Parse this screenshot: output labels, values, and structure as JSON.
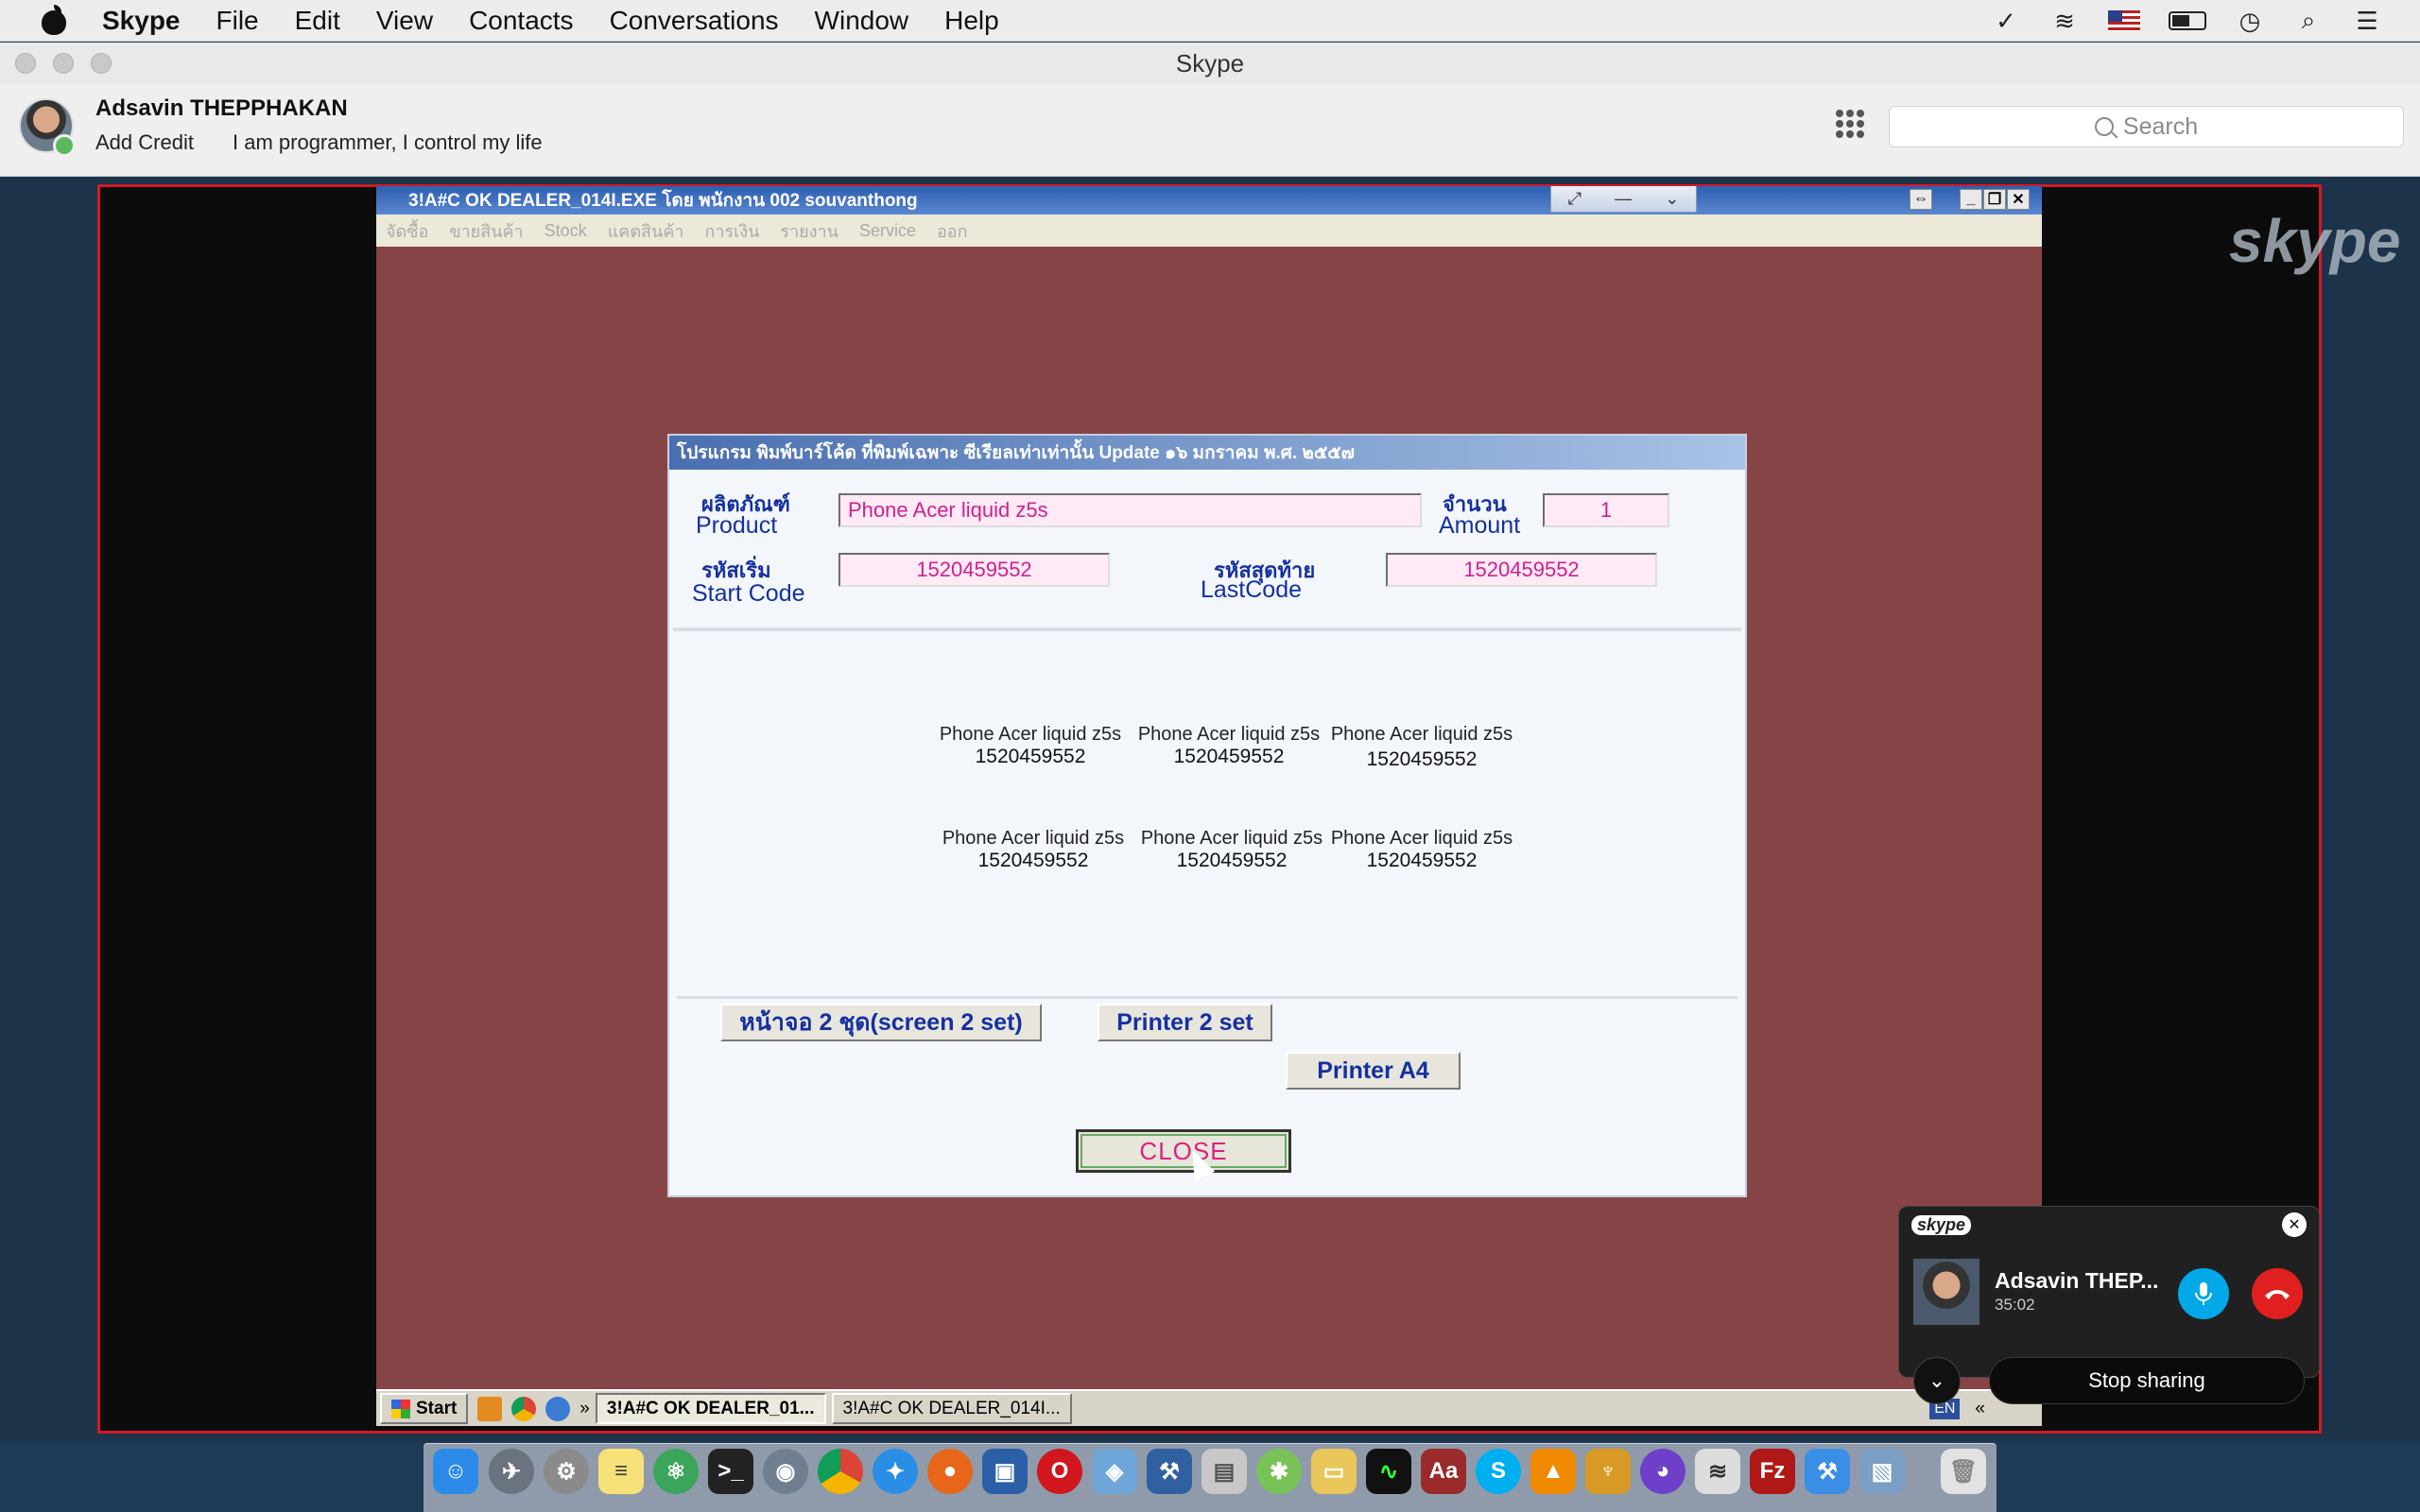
{
  "menubar": {
    "app": "Skype",
    "items": [
      "File",
      "Edit",
      "View",
      "Contacts",
      "Conversations",
      "Window",
      "Help"
    ],
    "status_icons": [
      "checkmark-shield-icon",
      "wifi-icon",
      "us-flag-icon",
      "battery-icon",
      "clock-icon",
      "spotlight-icon",
      "notification-list-icon"
    ]
  },
  "window": {
    "title": "Skype"
  },
  "profile": {
    "name": "Adsavin THEPPHAKAN",
    "add_credit": "Add Credit",
    "mood": "I am programmer, I control my life"
  },
  "search": {
    "placeholder": "Search"
  },
  "remote": {
    "title": "3!A#C OK DEALER_014I.EXE โดย พนักงาน 002 souvanthong",
    "menu": [
      "จัดซื้อ",
      "ขายสินค้า",
      "Stock",
      "แคตสินค้า",
      "การเงิน",
      "รายงาน",
      "Service",
      "ออก"
    ],
    "taskbar": {
      "start": "Start",
      "items": [
        "3!A#C OK DEALER_01...",
        "3!A#C OK DEALER_014I..."
      ],
      "lang": "EN"
    }
  },
  "dialog": {
    "title": "โปรแกรม พิมพ์บาร์โค้ด ที่พิมพ์เฉพาะ ซีเรียลเท่าเท่านั้น Update ๑๖ มกราคม พ.ศ. ๒๕๕๗",
    "product_label_th": "ผลิตภัณฑ์",
    "product_label_en": "Product",
    "product_value": "Phone Acer liquid z5s",
    "amount_label_th": "จำนวน",
    "amount_label_en": "Amount",
    "amount_value": "1",
    "start_label_th": "รหัสเริ่ม",
    "start_label_en": "Start Code",
    "start_value": "1520459552",
    "last_label_th": "รหัสสุดท้าย",
    "last_label_en": "LastCode",
    "last_value": "1520459552",
    "labels": [
      {
        "name": "Phone Acer liquid z5s",
        "code": "1520459552"
      },
      {
        "name": "Phone Acer liquid z5s",
        "code": "1520459552"
      },
      {
        "name": "Phone Acer liquid z5s",
        "code": "1520459552"
      },
      {
        "name": "Phone Acer liquid z5s",
        "code": "1520459552"
      },
      {
        "name": "Phone Acer liquid z5s",
        "code": "1520459552"
      },
      {
        "name": "Phone Acer liquid z5s",
        "code": "1520459552"
      }
    ],
    "btn_screen": "หน้าจอ  2 ชุด(screen 2 set)",
    "btn_printer2": "Printer 2 set",
    "btn_a4": "Printer A4",
    "btn_close": "CLOSE"
  },
  "call": {
    "brand": "skype",
    "name": "Adsavin THEP...",
    "duration": "35:02",
    "stop_sharing": "Stop sharing"
  },
  "watermark": "skype",
  "dock": [
    "finder-icon",
    "launchpad-icon",
    "system-preferences-icon",
    "notes-icon",
    "atom-icon",
    "terminal-icon",
    "sequel-pro-icon",
    "chrome-icon",
    "safari-icon",
    "firefox-icon",
    "remote-desktop-icon",
    "opera-icon",
    "virtualbox-icon",
    "xcode-instruments-icon",
    "database-icon",
    "android-studio-icon",
    "folder-icon",
    "activity-monitor-icon",
    "dictionary-icon",
    "skype-icon",
    "vlc-icon",
    "app-icon",
    "github-icon",
    "wifi-utility-icon",
    "filezilla-icon",
    "xcode-icon",
    "preview-icon",
    "trash-icon"
  ]
}
